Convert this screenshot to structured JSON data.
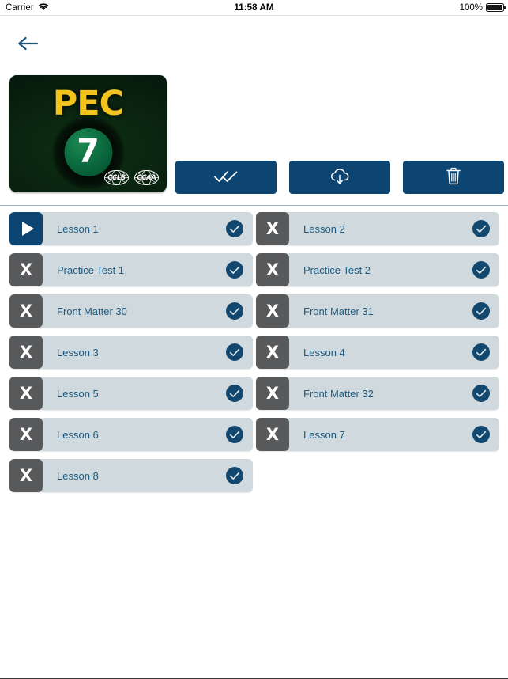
{
  "status_bar": {
    "carrier": "Carrier",
    "wifi_icon": "wifi-icon",
    "time": "11:58 AM",
    "battery_percent": "100%",
    "battery_icon": "battery-full-icon"
  },
  "nav": {
    "back_icon": "arrow-left-icon"
  },
  "book": {
    "title_text": "PEC",
    "number": "7",
    "logo_left": "CCLS",
    "logo_right": "CCAA",
    "cover_colors": {
      "background": "#0a2410",
      "title": "#f2c31d",
      "ball": "#0e7043"
    }
  },
  "toolbar": {
    "accent_color": "#0d4572",
    "buttons": [
      {
        "name": "select-all-button",
        "icon": "double-check-icon"
      },
      {
        "name": "download-button",
        "icon": "cloud-download-icon"
      },
      {
        "name": "delete-button",
        "icon": "trash-icon"
      }
    ]
  },
  "list": {
    "row_background": "#cfd9de",
    "label_color": "#1d5c80",
    "check_color": "#12486f",
    "left_column": [
      {
        "label": "Lesson 1",
        "tile": "play",
        "tile_glyph": "",
        "checked": true
      },
      {
        "label": "Practice Test 1",
        "tile": "x",
        "tile_glyph": "X",
        "checked": true
      },
      {
        "label": "Front Matter 30",
        "tile": "x",
        "tile_glyph": "X",
        "checked": true
      },
      {
        "label": "Lesson 3",
        "tile": "x",
        "tile_glyph": "X",
        "checked": true
      },
      {
        "label": "Lesson 5",
        "tile": "x",
        "tile_glyph": "X",
        "checked": true
      },
      {
        "label": "Lesson 6",
        "tile": "x",
        "tile_glyph": "X",
        "checked": true
      },
      {
        "label": "Lesson 8",
        "tile": "x",
        "tile_glyph": "X",
        "checked": true
      }
    ],
    "right_column": [
      {
        "label": "Lesson 2",
        "tile": "x",
        "tile_glyph": "X",
        "checked": true
      },
      {
        "label": "Practice Test 2",
        "tile": "x",
        "tile_glyph": "X",
        "checked": true
      },
      {
        "label": "Front Matter 31",
        "tile": "x",
        "tile_glyph": "X",
        "checked": true
      },
      {
        "label": "Lesson 4",
        "tile": "x",
        "tile_glyph": "X",
        "checked": true
      },
      {
        "label": "Front Matter 32",
        "tile": "x",
        "tile_glyph": "X",
        "checked": true
      },
      {
        "label": "Lesson 7",
        "tile": "x",
        "tile_glyph": "X",
        "checked": true
      }
    ]
  }
}
